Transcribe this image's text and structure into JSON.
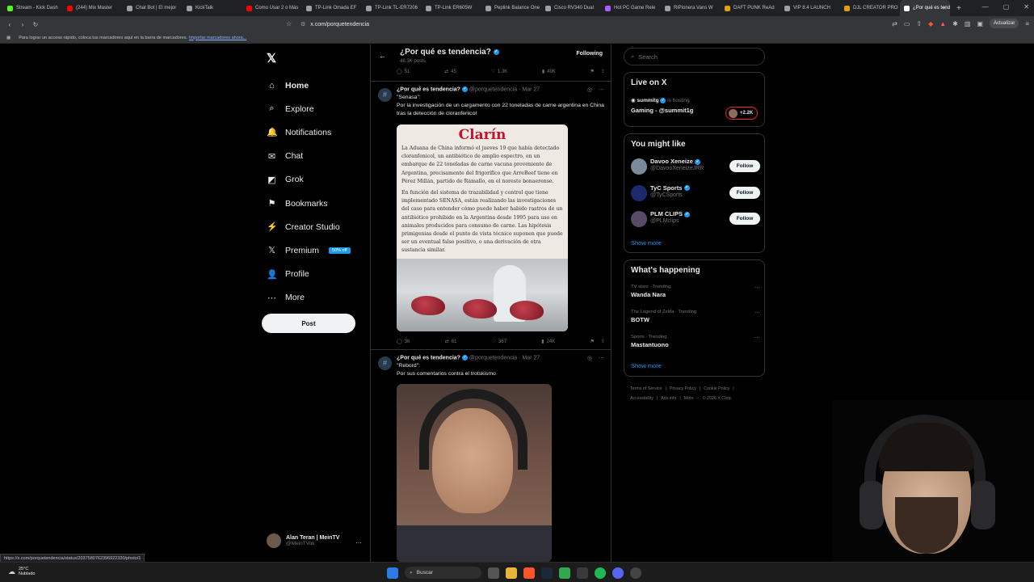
{
  "browser": {
    "tabs": [
      {
        "label": "Stream - Kick Dash",
        "color": "#53fc18"
      },
      {
        "label": "(244) Mix Master",
        "color": "#ff0000"
      },
      {
        "label": "Chat Bot | El mejor",
        "color": "#9aa0a6"
      },
      {
        "label": "KickTalk",
        "color": "#9aa0a6"
      },
      {
        "label": "Como Usar 2 o Más",
        "color": "#ff0000"
      },
      {
        "label": "TP-Link Omada EF",
        "color": "#9aa0a6"
      },
      {
        "label": "TP-Link TL-ER7206",
        "color": "#9aa0a6"
      },
      {
        "label": "TP-Link ER605W",
        "color": "#9aa0a6"
      },
      {
        "label": "Peplink Balance One",
        "color": "#9aa0a6"
      },
      {
        "label": "Cisco RV340 Dual",
        "color": "#9aa0a6"
      },
      {
        "label": "Hot PC Game Rele",
        "color": "#b05cff"
      },
      {
        "label": "RiPionera Vans W",
        "color": "#9aa0a6"
      },
      {
        "label": "DAFT PUNK ReAd",
        "color": "#e0a000"
      },
      {
        "label": "VIP 8.4 LAUNCH",
        "color": "#9aa0a6"
      },
      {
        "label": "DJL CREATOR PRO",
        "color": "#e0a000"
      },
      {
        "label": "¿Por qué es tend",
        "color": "#ffffff",
        "active": true
      }
    ],
    "new_tab": "+",
    "window_controls": [
      "—",
      "▢",
      "✕"
    ],
    "url": "x.com/porquetendencia",
    "update_label": "Actualizar",
    "bookmarks_text": "Para lograr un acceso rápido, coloca tus marcadores aquí en la barra de marcadores.",
    "bookmarks_link": "Importar marcadores ahora..."
  },
  "nav": {
    "logo": "𝕏",
    "items": [
      {
        "icon": "⌂",
        "label": "Home",
        "active": true
      },
      {
        "icon": "⌕",
        "label": "Explore"
      },
      {
        "icon": "🔔",
        "label": "Notifications"
      },
      {
        "icon": "✉",
        "label": "Chat"
      },
      {
        "icon": "◩",
        "label": "Grok"
      },
      {
        "icon": "⚑",
        "label": "Bookmarks"
      },
      {
        "icon": "⚡",
        "label": "Creator Studio"
      },
      {
        "icon": "𝕏",
        "label": "Premium",
        "badge": "50% off"
      },
      {
        "icon": "👤",
        "label": "Profile"
      },
      {
        "icon": "⋯",
        "label": "More"
      }
    ],
    "post_label": "Post"
  },
  "account": {
    "name": "Alan Teran | MeinTV",
    "handle": "@MeinTVok",
    "more": "…"
  },
  "status_url": "https://x.com/porquetendencia/status/2037580762396922330/photo/1",
  "header": {
    "title": "¿Por qué es tendencia?",
    "posts": "48.3K posts",
    "following": "Following",
    "back": "←"
  },
  "top_actions": {
    "replies": "51",
    "reposts": "45",
    "likes": "1.3K",
    "views": "49K"
  },
  "tweets": [
    {
      "name": "¿Por qué es tendencia?",
      "handle": "@porquetendencia · Mar 27",
      "quote": "\"Senasa\":",
      "text": "Por la investigación de un cargamento con 22 toneladas de carne argentina en China tras la detección de cloranfenicol",
      "image": {
        "logo": "Clarín",
        "p1": "La Aduana de China informó el jueves 19 que había detectado cloranfenicol, un antibiótico de amplio espectro, en un embarque de 22 toneladas de carne vacuna proveniente de Argentina, precisamente del frigorífico que ArreBeef tiene en Pérez Millán, partido de Ramallo, en el noreste bonaerense.",
        "p2": "En función del sistema de trazabilidad y control que tiene implementado SENASA, están realizando las investigaciones del caso para entender cómo puede haber habido rastros de un antibiótico prohibido en la Argentina desde 1995 para uso en animales producidos para consumo de carne. Las hipótesis primigenias desde el punto de vista técnico suponen que puede ser un eventual falso positivo, o una derivación de otra sustancia similar."
      },
      "actions": {
        "replies": "36",
        "reposts": "61",
        "likes": "367",
        "views": "24K"
      }
    },
    {
      "name": "¿Por qué es tendencia?",
      "handle": "@porquetendencia · Mar 27",
      "quote": "\"Rebord\":",
      "text": "Por sus comentarios contra el trotskismo"
    }
  ],
  "sidebar": {
    "search_placeholder": "Search",
    "live": {
      "title": "Live on X",
      "user": "summitg",
      "hosting": "is hosting",
      "game": "Gaming - @summit1g",
      "count": "+2.2K"
    },
    "suggest": {
      "title": "You might like",
      "users": [
        {
          "name": "Davoo Xeneize",
          "handle": "@DavooXeneizeJRR",
          "color": "#7a8a9a"
        },
        {
          "name": "TyC Sports",
          "handle": "@TyCSports",
          "color": "#1a2a6c"
        },
        {
          "name": "PLM CLIPS",
          "handle": "@PLMclips",
          "color": "#5a4a6a"
        }
      ],
      "follow_label": "Follow",
      "show_more": "Show more"
    },
    "happening": {
      "title": "What's happening",
      "trends": [
        {
          "context": "TV stars · Trending",
          "name": "Wanda Nara"
        },
        {
          "context": "The Legend of Zelda · Trending",
          "name": "BOTW"
        },
        {
          "context": "Sports · Trending",
          "name": "Mastantuono"
        }
      ],
      "show_more": "Show more"
    },
    "footer": {
      "line1": [
        "Terms of Service",
        "|",
        "Privacy Policy",
        "|",
        "Cookie Policy",
        "|"
      ],
      "line2": [
        "Accessibility",
        "|",
        "Ads info",
        "|",
        "More ···",
        "© 2026 X Corp."
      ]
    }
  },
  "taskbar": {
    "temp": "25°C",
    "weather": "Nublado",
    "search": "Buscar"
  }
}
